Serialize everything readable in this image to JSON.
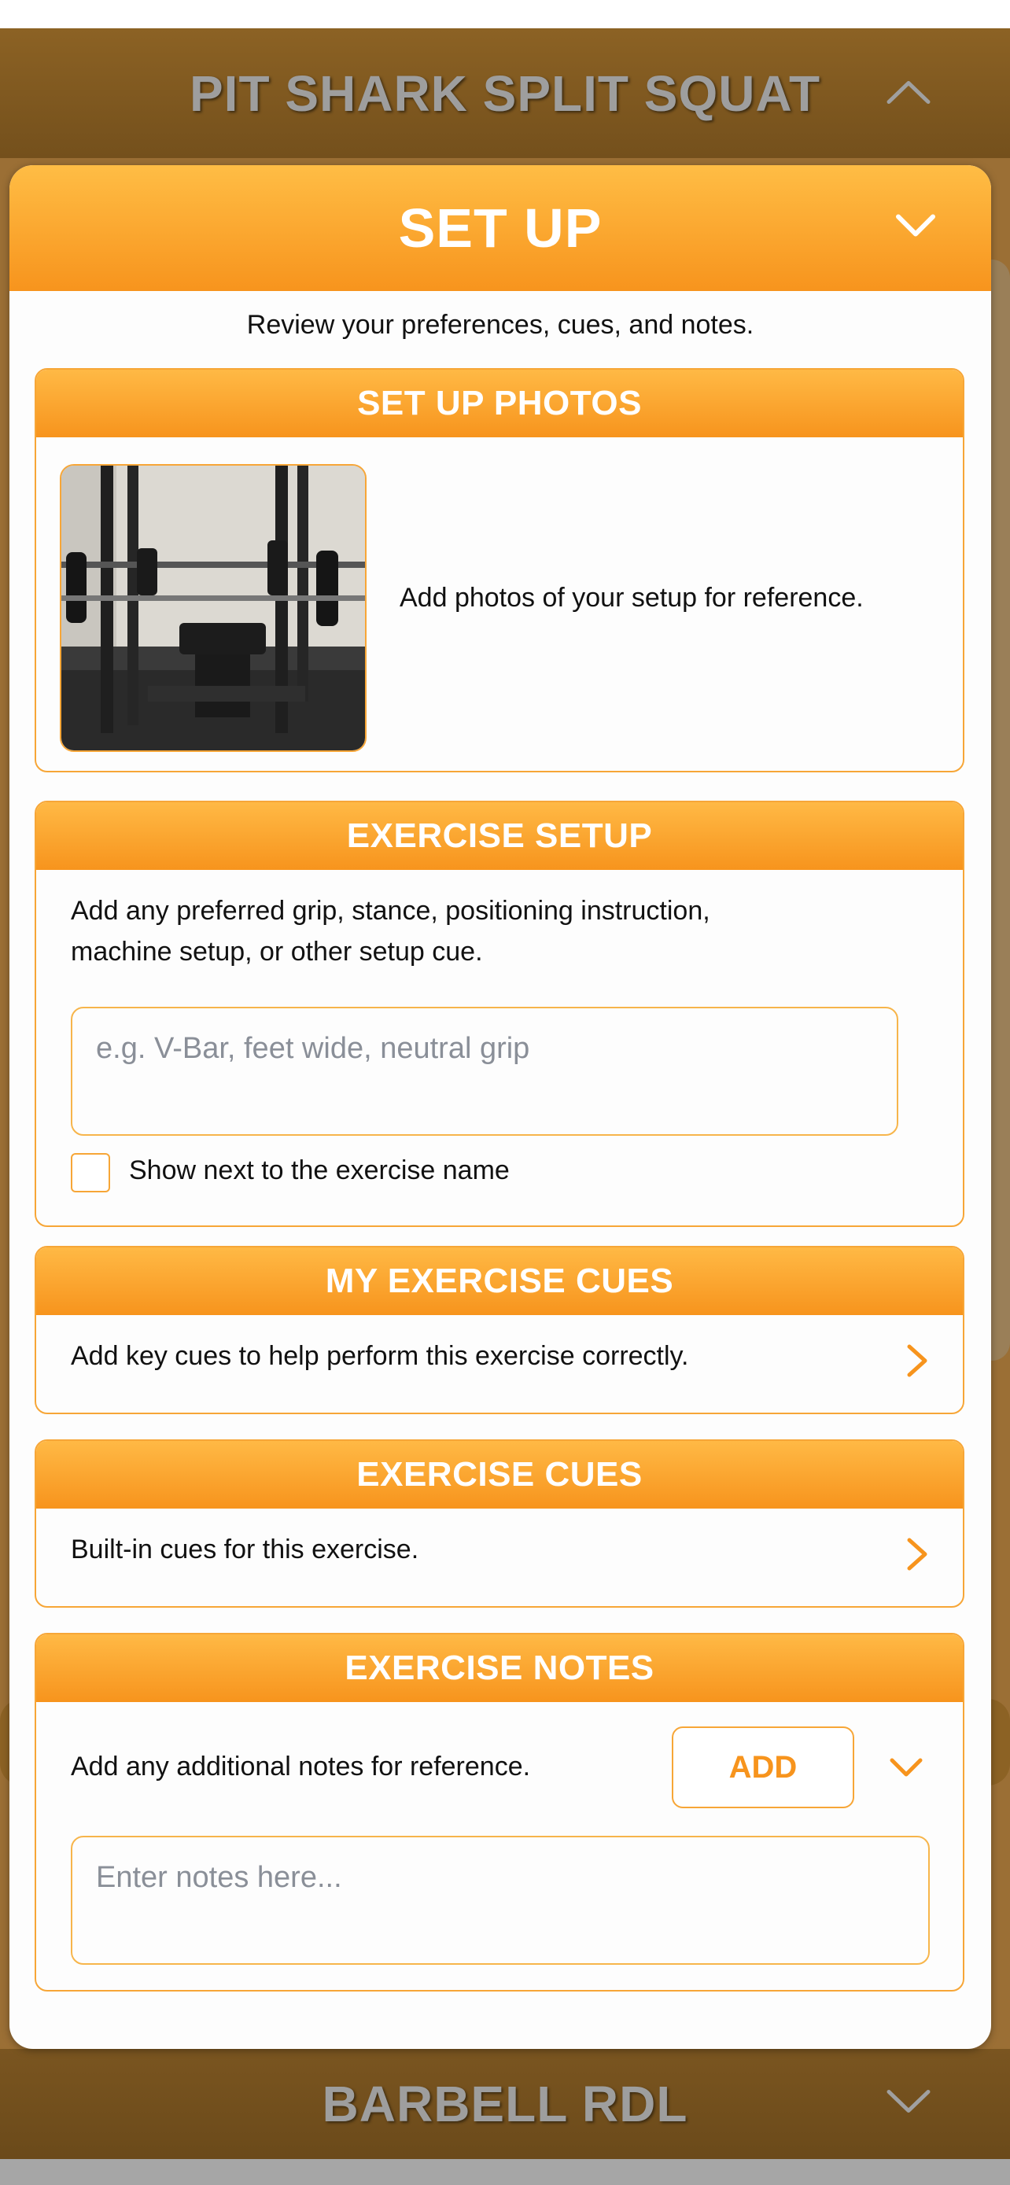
{
  "background": {
    "top_exercise": "PIT SHARK SPLIT SQUAT",
    "bottom_exercise": "BARBELL RDL"
  },
  "modal": {
    "title": "SET UP",
    "subtitle": "Review your preferences, cues, and notes."
  },
  "setup_photos": {
    "header": "SET UP PHOTOS",
    "description": "Add photos of your setup for reference."
  },
  "exercise_setup": {
    "header": "EXERCISE SETUP",
    "description_line1": "Add any preferred grip, stance, positioning instruction,",
    "description_line2": "machine setup, or other setup cue.",
    "input_placeholder": "e.g. V-Bar, feet wide, neutral grip",
    "checkbox_label": "Show next to the exercise name",
    "checkbox_checked": false
  },
  "my_exercise_cues": {
    "header": "MY EXERCISE CUES",
    "description": "Add key cues to help perform this exercise correctly."
  },
  "exercise_cues": {
    "header": "EXERCISE CUES",
    "description": "Built-in cues for this exercise."
  },
  "exercise_notes": {
    "header": "EXERCISE NOTES",
    "description": "Add any additional notes for reference.",
    "add_label": "ADD",
    "notes_placeholder": "Enter notes here..."
  },
  "colors": {
    "accent": "#f7941d",
    "accent_light": "#ffbd45",
    "background_header": "#7a5520"
  }
}
